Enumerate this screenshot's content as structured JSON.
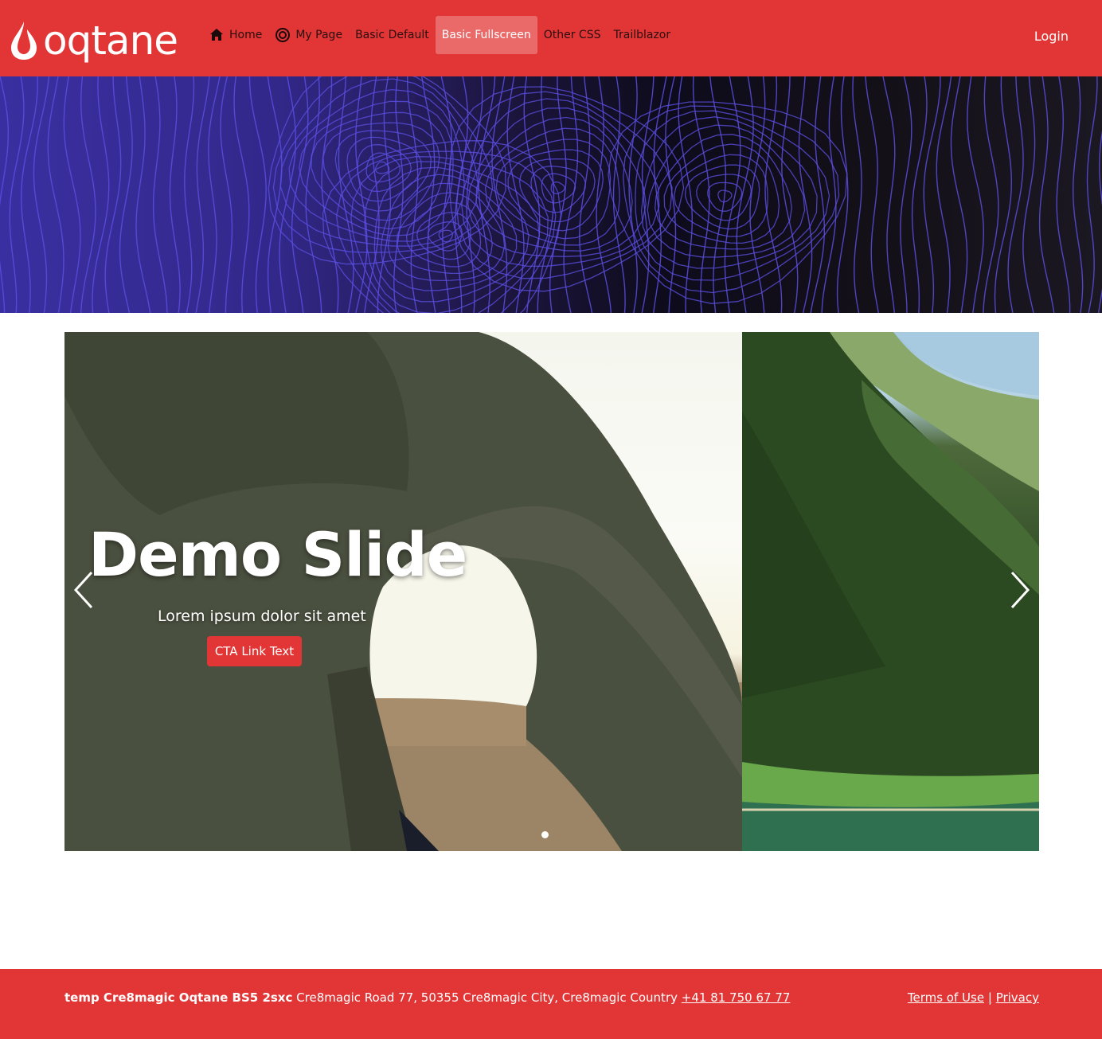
{
  "header": {
    "logo_text": "oqtane",
    "nav": [
      {
        "label": "Home",
        "icon": "home-icon",
        "active": false
      },
      {
        "label": "My Page",
        "icon": "target-icon",
        "active": false
      },
      {
        "label": "Basic Default",
        "icon": null,
        "active": false
      },
      {
        "label": "Basic Fullscreen",
        "icon": null,
        "active": true
      },
      {
        "label": "Other CSS",
        "icon": null,
        "active": false
      },
      {
        "label": "Trailblazor",
        "icon": null,
        "active": false
      }
    ],
    "login_label": "Login"
  },
  "carousel": {
    "title": "Demo Slide",
    "subtitle": "Lorem ipsum dolor sit amet",
    "cta_label": "CTA Link Text",
    "indicators": 1,
    "active_indicator": 0
  },
  "footer": {
    "company": "temp Cre8magic Oqtane BS5 2sxc",
    "address": "Cre8magic Road 77, 50355 Cre8magic City, Cre8magic Country",
    "phone": "+41 81 750 67 77",
    "terms_label": "Terms of Use",
    "separator": "|",
    "privacy_label": "Privacy"
  },
  "colors": {
    "brand_red": "#e23636",
    "active_nav": "#ea6a6a",
    "banner_lines": "#5a4ee0"
  }
}
